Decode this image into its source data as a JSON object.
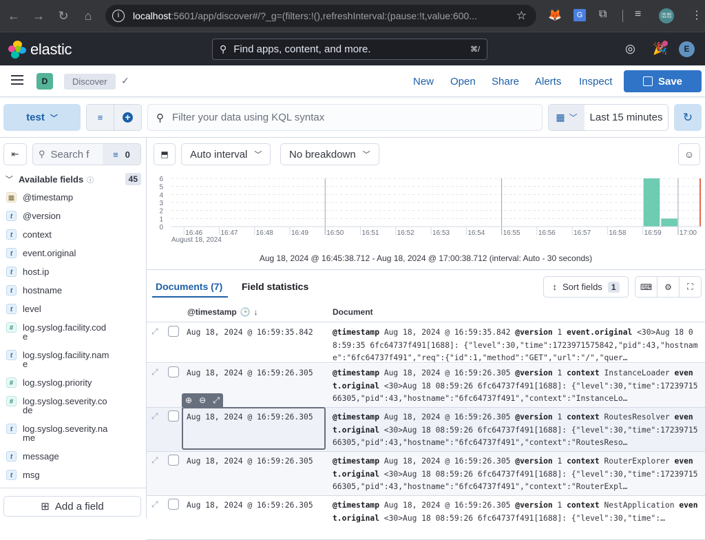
{
  "browser": {
    "url_host": "localhost",
    "url_rest": ":5601/app/discover#/?_g=(filters:!(),refreshInterval:(pause:!t,value:600...",
    "profile_label": "浩哲"
  },
  "header": {
    "brand": "elastic",
    "search_placeholder": "Find apps, content, and more.",
    "search_shortcut": "⌘/",
    "avatar_initial": "E"
  },
  "appbar": {
    "space_initial": "D",
    "breadcrumb": "Discover",
    "links": [
      "New",
      "Open",
      "Share",
      "Alerts",
      "Inspect"
    ],
    "save_label": "Save"
  },
  "query": {
    "data_view": "test",
    "kql_placeholder": "Filter your data using KQL syntax",
    "time_range": "Last 15 minutes"
  },
  "sidebar": {
    "search_placeholder": "Search f",
    "filter_count": "0",
    "section_title": "Available fields",
    "field_count": "45",
    "fields": [
      {
        "type": "date",
        "name": "@timestamp"
      },
      {
        "type": "text",
        "name": "@version"
      },
      {
        "type": "text",
        "name": "context"
      },
      {
        "type": "text",
        "name": "event.original"
      },
      {
        "type": "text",
        "name": "host.ip"
      },
      {
        "type": "text",
        "name": "hostname"
      },
      {
        "type": "text",
        "name": "level"
      },
      {
        "type": "number",
        "name": "log.syslog.facility.code"
      },
      {
        "type": "text",
        "name": "log.syslog.facility.name"
      },
      {
        "type": "number",
        "name": "log.syslog.priority"
      },
      {
        "type": "number",
        "name": "log.syslog.severity.code"
      },
      {
        "type": "text",
        "name": "log.syslog.severity.name"
      },
      {
        "type": "text",
        "name": "message"
      },
      {
        "type": "text",
        "name": "msg"
      }
    ],
    "add_field_label": "Add a field"
  },
  "histogram_toolbar": {
    "interval": "Auto interval",
    "breakdown": "No breakdown"
  },
  "chart_data": {
    "type": "bar",
    "title": "",
    "xlabel": "",
    "ylabel": "",
    "ylim": [
      0,
      6
    ],
    "yticks": [
      "0",
      "1",
      "2",
      "3",
      "4",
      "5",
      "6"
    ],
    "xticks": [
      "16:46",
      "16:47",
      "16:48",
      "16:49",
      "16:50",
      "16:51",
      "16:52",
      "16:53",
      "16:54",
      "16:55",
      "16:56",
      "16:57",
      "16:58",
      "16:59",
      "17:00"
    ],
    "x_sublabel": "August 18, 2024",
    "x_range": [
      "16:45:38.712",
      "17:00:38.712"
    ],
    "interval_seconds": 30,
    "categories": [
      "16:59:00",
      "16:59:30"
    ],
    "values": [
      6,
      1
    ],
    "bar_color": "#6dccb1",
    "grid": true
  },
  "range_label": "Aug 18, 2024 @ 16:45:38.712 - Aug 18, 2024 @ 17:00:38.712 (interval: Auto - 30 seconds)",
  "tabs": {
    "documents": "Documents (7)",
    "field_statistics": "Field statistics"
  },
  "table": {
    "sort_fields_label": "Sort fields",
    "sort_count": "1",
    "col_timestamp": "@timestamp",
    "col_document": "Document",
    "rows": [
      {
        "timestamp": "Aug 18, 2024 @ 16:59:35.842",
        "doc": [
          [
            "@timestamp",
            " Aug 18, 2024 @ 16:59:35.842 "
          ],
          [
            "@version",
            " 1 "
          ],
          [
            "event.original",
            " <30>Aug 18 08:59:35 6fc64737f491[1688]: {\"level\":30,\"time\":1723971575842,\"pid\":43,\"hostname\":\"6fc64737f491\",\"req\":{\"id\":1,\"method\":\"GET\",\"url\":\"/\",\"quer…"
          ]
        ]
      },
      {
        "timestamp": "Aug 18, 2024 @ 16:59:26.305",
        "doc": [
          [
            "@timestamp",
            " Aug 18, 2024 @ 16:59:26.305 "
          ],
          [
            "@version",
            " 1 "
          ],
          [
            "context",
            " InstanceLoader "
          ],
          [
            "event.original",
            " <30>Aug 18 08:59:26 6fc64737f491[1688]: {\"level\":30,\"time\":1723971566305,\"pid\":43,\"hostname\":\"6fc64737f491\",\"context\":\"InstanceLo…"
          ]
        ]
      },
      {
        "timestamp": "Aug 18, 2024 @ 16:59:26.305",
        "doc": [
          [
            "@timestamp",
            " Aug 18, 2024 @ 16:59:26.305 "
          ],
          [
            "@version",
            " 1 "
          ],
          [
            "context",
            " RoutesResolver "
          ],
          [
            "event.original",
            " <30>Aug 18 08:59:26 6fc64737f491[1688]: {\"level\":30,\"time\":1723971566305,\"pid\":43,\"hostname\":\"6fc64737f491\",\"context\":\"RoutesReso…"
          ]
        ]
      },
      {
        "timestamp": "Aug 18, 2024 @ 16:59:26.305",
        "doc": [
          [
            "@timestamp",
            " Aug 18, 2024 @ 16:59:26.305 "
          ],
          [
            "@version",
            " 1 "
          ],
          [
            "context",
            " RouterExplorer "
          ],
          [
            "event.original",
            " <30>Aug 18 08:59:26 6fc64737f491[1688]: {\"level\":30,\"time\":1723971566305,\"pid\":43,\"hostname\":\"6fc64737f491\",\"context\":\"RouterExpl…"
          ]
        ]
      },
      {
        "timestamp": "Aug 18, 2024 @ 16:59:26.305",
        "doc": [
          [
            "@timestamp",
            " Aug 18, 2024 @ 16:59:26.305 "
          ],
          [
            "@version",
            " 1 "
          ],
          [
            "context",
            " NestApplication "
          ],
          [
            "event.original",
            " <30>Aug 18 08:59:26 6fc64737f491[1688]: {\"level\":30,\"time\":…"
          ]
        ]
      }
    ]
  }
}
